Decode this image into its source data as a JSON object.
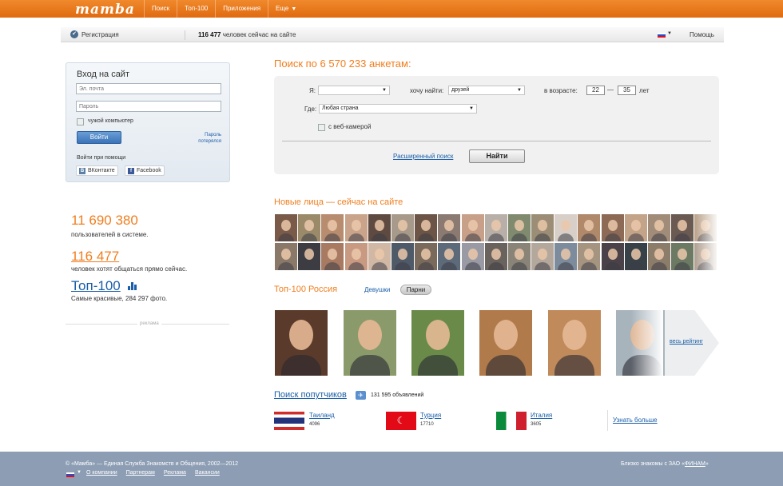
{
  "topbar": {
    "logo": "mamba",
    "nav": [
      "Поиск",
      "Топ-100",
      "Приложения",
      "Еще"
    ]
  },
  "subbar": {
    "register": "Регистрация",
    "online_count": "116 477",
    "online_text": "человек сейчас на сайте",
    "help": "Помощь"
  },
  "login": {
    "title": "Вход на сайт",
    "email_placeholder": "Эл. почта",
    "password_placeholder": "Пароль",
    "foreign_computer": "чужой компьютер",
    "submit": "Войти",
    "lost_password": "Пароль потерялся",
    "via": "Войти при помощи",
    "vk": "ВКонтакте",
    "facebook": "Facebook"
  },
  "stats": {
    "users": "11 690 380",
    "users_label": "пользователей в системе.",
    "online": "116 477",
    "online_label": "человек хотят общаться прямо сейчас.",
    "top": "Топ-100",
    "top_label": "Самые красивые, 284 297 фото."
  },
  "ad_label": "реклама",
  "search": {
    "title": "Поиск по 6 570 233 анкетам:",
    "me_label": "Я:",
    "me_value": "",
    "find_label": "хочу найти:",
    "find_value": "друзей",
    "age_label": "в возрасте:",
    "age_from": "22",
    "age_dash": "—",
    "age_to": "35",
    "age_unit": "лет",
    "where_label": "Где:",
    "where_value": "Любая страна",
    "webcam": "с веб-камерой",
    "advanced": "Расширенный поиск",
    "submit": "Найти"
  },
  "faces": {
    "title": "Новые лица — сейчас на сайте",
    "tints": [
      "#7a5a48",
      "#9a8a6a",
      "#b88c6e",
      "#c9a48a",
      "#5e4a40",
      "#a89a8a",
      "#6c5446",
      "#8a7a72",
      "#c8a08a",
      "#b8b0a8",
      "#7f8a6e",
      "#9c8e76",
      "#d8d0c8",
      "#b0886a",
      "#8c6a56",
      "#c4a488",
      "#a08c78",
      "#6a5a52",
      "#bca48c",
      "#8a7868",
      "#3c3c42",
      "#a87a62",
      "#c89a82",
      "#d0b8a4",
      "#4e5a68",
      "#7a6a5c",
      "#5c6a7a",
      "#9a9aa4",
      "#6a625c",
      "#8a8478",
      "#b4a89c",
      "#7c8c9c",
      "#a49480",
      "#4a4248",
      "#384048",
      "#8c7c6a",
      "#6c7a64",
      "#b2a294"
    ]
  },
  "top100": {
    "title": "Топ-100 Россия",
    "tab_girls": "Девушки",
    "tab_boys": "Парни",
    "all_rating": "весь рейтинг",
    "photo_tints": [
      "#5a3a2a",
      "#8a9a6a",
      "#6a8a4a",
      "#b07a4a",
      "#c08a5a",
      "#a8b4bc"
    ]
  },
  "travel": {
    "title": "Поиск попутчиков",
    "count": "131 595 объявлений",
    "countries": [
      {
        "name": "Таиланд",
        "count": "4096"
      },
      {
        "name": "Турция",
        "count": "17710"
      },
      {
        "name": "Италия",
        "count": "3605"
      }
    ],
    "learn_more": "Узнать больше"
  },
  "footer": {
    "copyright": "© «Мамба» — Единая Служба Знакомств и Общения, 2002—2012",
    "partner_prefix": "Близко знакомы с ЗАО «",
    "partner_name": "ФИНАМ",
    "partner_suffix": "»",
    "links": [
      "О компании",
      "Партнерам",
      "Реклама",
      "Вакансии"
    ]
  }
}
